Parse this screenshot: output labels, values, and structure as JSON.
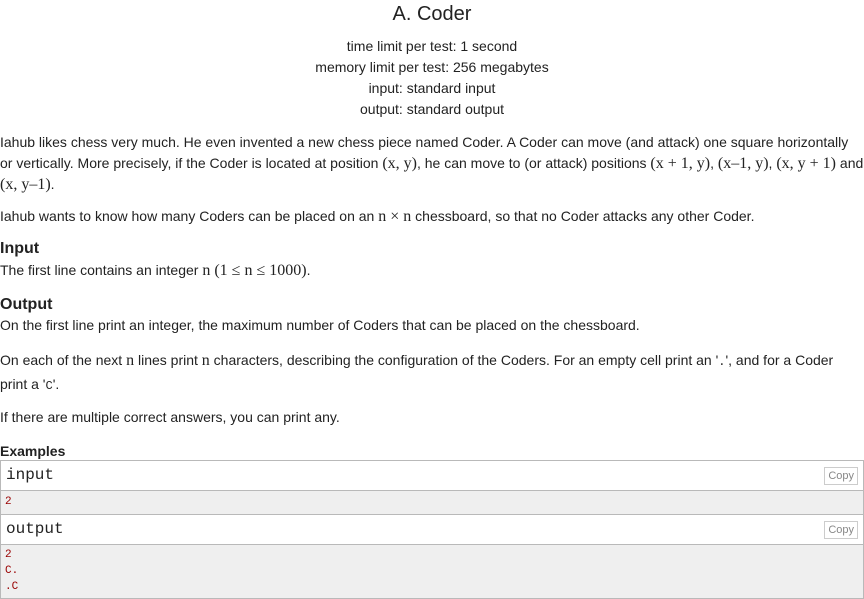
{
  "problem": {
    "title": "A. Coder",
    "limits": {
      "time": "time limit per test: 1 second",
      "memory": "memory limit per test: 256 megabytes",
      "input": "input: standard input",
      "output": "output: standard output"
    }
  },
  "statement": {
    "p1_a": "Iahub likes chess very much. He even invented a new chess piece named Coder. A Coder can move (and attack) one square horizontally or vertically. More precisely, if the Coder is located at position ",
    "p1_pos": "(x, y)",
    "p1_b": ", he can move to (or attack) positions ",
    "p1_m1": "(x + 1, y)",
    "p1_m2": "(x–1, y)",
    "p1_m3": "(x, y + 1)",
    "p1_and": " and ",
    "p1_m4": "(x, y–1)",
    "p2_a": "Iahub wants to know how many Coders can be placed on an ",
    "p2_m": "n × n",
    "p2_b": " chessboard, so that no Coder attacks any other Coder."
  },
  "input_section": {
    "heading": "Input",
    "text_a": "The first line contains an integer ",
    "text_m": "n (1 ≤ n ≤ 1000)"
  },
  "output_section": {
    "heading": "Output",
    "p1": "On the first line print an integer, the maximum number of Coders that can be placed on the chessboard.",
    "p2_a": "On each of the next ",
    "p2_n1": "n",
    "p2_b": " lines print ",
    "p2_n2": "n",
    "p2_c": " characters, describing the configuration of the Coders. For an empty cell print an '",
    "p2_dot": ".",
    "p2_d": "', and for a Coder print a '",
    "p2_c_char": "C",
    "p2_e": "'.",
    "p3": "If there are multiple correct answers, you can print any."
  },
  "examples": {
    "heading": "Examples",
    "copy_label": "Copy",
    "input_label": "input",
    "input_lines": [
      "2"
    ],
    "output_label": "output",
    "output_lines": [
      "2",
      "C.",
      ".C"
    ]
  }
}
